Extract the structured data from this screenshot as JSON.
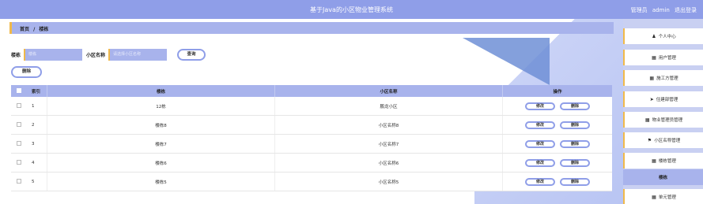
{
  "header": {
    "title": "基于Java的小区物业管理系统",
    "user_role": "管理员",
    "user_name": "admin",
    "logout": "退出登录"
  },
  "breadcrumb": {
    "home": "首页",
    "sep": "/",
    "current": "楼栋"
  },
  "search": {
    "ld_label": "楼栋",
    "ld_placeholder": "楼栋",
    "xq_label": "小区名称",
    "xq_placeholder": "请选择小区名称",
    "button": "查询"
  },
  "actions": {
    "delete": "删除"
  },
  "table": {
    "headers": {
      "index": "索引",
      "ld": "楼栋",
      "xq": "小区名称",
      "op": "操作"
    },
    "edit_label": "修改",
    "delete_label": "删除",
    "rows": [
      {
        "index": "1",
        "ld": "12栋",
        "xq": "鹏龙小区"
      },
      {
        "index": "2",
        "ld": "楼栋8",
        "xq": "小区名称8"
      },
      {
        "index": "3",
        "ld": "楼栋7",
        "xq": "小区名称7"
      },
      {
        "index": "4",
        "ld": "楼栋6",
        "xq": "小区名称6"
      },
      {
        "index": "5",
        "ld": "楼栋5",
        "xq": "小区名称5"
      }
    ]
  },
  "sidebar": {
    "items": [
      {
        "label": "个人中心",
        "icon": "user-icon"
      },
      {
        "label": "用户管理",
        "icon": "grid-icon"
      },
      {
        "label": "施工方管理",
        "icon": "grid-icon"
      },
      {
        "label": "住建部管理",
        "icon": "send-icon"
      },
      {
        "label": "物业管理员管理",
        "icon": "grid-icon"
      },
      {
        "label": "小区名称管理",
        "icon": "flag-icon"
      },
      {
        "label": "楼栋管理",
        "icon": "grid-icon"
      },
      {
        "label": "楼栋",
        "icon": ""
      },
      {
        "label": "单元管理",
        "icon": "grid-icon"
      }
    ]
  },
  "colors": {
    "primary": "#8f9ee8",
    "header_bg": "#a8b3ec",
    "accent": "#f0b94a",
    "deco_blue": "#6f8fd6"
  }
}
